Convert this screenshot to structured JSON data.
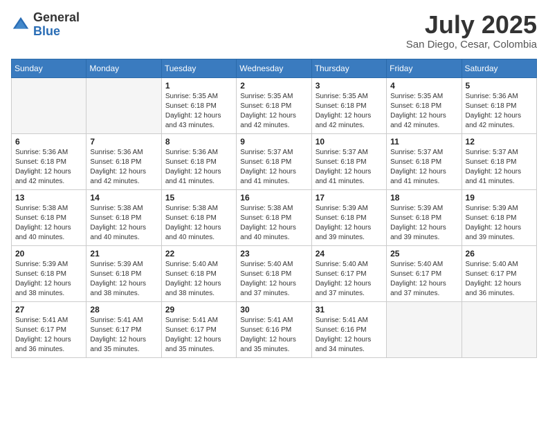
{
  "header": {
    "logo_general": "General",
    "logo_blue": "Blue",
    "month_title": "July 2025",
    "location": "San Diego, Cesar, Colombia"
  },
  "days_of_week": [
    "Sunday",
    "Monday",
    "Tuesday",
    "Wednesday",
    "Thursday",
    "Friday",
    "Saturday"
  ],
  "weeks": [
    [
      {
        "num": "",
        "info": ""
      },
      {
        "num": "",
        "info": ""
      },
      {
        "num": "1",
        "info": "Sunrise: 5:35 AM\nSunset: 6:18 PM\nDaylight: 12 hours\nand 43 minutes."
      },
      {
        "num": "2",
        "info": "Sunrise: 5:35 AM\nSunset: 6:18 PM\nDaylight: 12 hours\nand 42 minutes."
      },
      {
        "num": "3",
        "info": "Sunrise: 5:35 AM\nSunset: 6:18 PM\nDaylight: 12 hours\nand 42 minutes."
      },
      {
        "num": "4",
        "info": "Sunrise: 5:35 AM\nSunset: 6:18 PM\nDaylight: 12 hours\nand 42 minutes."
      },
      {
        "num": "5",
        "info": "Sunrise: 5:36 AM\nSunset: 6:18 PM\nDaylight: 12 hours\nand 42 minutes."
      }
    ],
    [
      {
        "num": "6",
        "info": "Sunrise: 5:36 AM\nSunset: 6:18 PM\nDaylight: 12 hours\nand 42 minutes."
      },
      {
        "num": "7",
        "info": "Sunrise: 5:36 AM\nSunset: 6:18 PM\nDaylight: 12 hours\nand 42 minutes."
      },
      {
        "num": "8",
        "info": "Sunrise: 5:36 AM\nSunset: 6:18 PM\nDaylight: 12 hours\nand 41 minutes."
      },
      {
        "num": "9",
        "info": "Sunrise: 5:37 AM\nSunset: 6:18 PM\nDaylight: 12 hours\nand 41 minutes."
      },
      {
        "num": "10",
        "info": "Sunrise: 5:37 AM\nSunset: 6:18 PM\nDaylight: 12 hours\nand 41 minutes."
      },
      {
        "num": "11",
        "info": "Sunrise: 5:37 AM\nSunset: 6:18 PM\nDaylight: 12 hours\nand 41 minutes."
      },
      {
        "num": "12",
        "info": "Sunrise: 5:37 AM\nSunset: 6:18 PM\nDaylight: 12 hours\nand 41 minutes."
      }
    ],
    [
      {
        "num": "13",
        "info": "Sunrise: 5:38 AM\nSunset: 6:18 PM\nDaylight: 12 hours\nand 40 minutes."
      },
      {
        "num": "14",
        "info": "Sunrise: 5:38 AM\nSunset: 6:18 PM\nDaylight: 12 hours\nand 40 minutes."
      },
      {
        "num": "15",
        "info": "Sunrise: 5:38 AM\nSunset: 6:18 PM\nDaylight: 12 hours\nand 40 minutes."
      },
      {
        "num": "16",
        "info": "Sunrise: 5:38 AM\nSunset: 6:18 PM\nDaylight: 12 hours\nand 40 minutes."
      },
      {
        "num": "17",
        "info": "Sunrise: 5:39 AM\nSunset: 6:18 PM\nDaylight: 12 hours\nand 39 minutes."
      },
      {
        "num": "18",
        "info": "Sunrise: 5:39 AM\nSunset: 6:18 PM\nDaylight: 12 hours\nand 39 minutes."
      },
      {
        "num": "19",
        "info": "Sunrise: 5:39 AM\nSunset: 6:18 PM\nDaylight: 12 hours\nand 39 minutes."
      }
    ],
    [
      {
        "num": "20",
        "info": "Sunrise: 5:39 AM\nSunset: 6:18 PM\nDaylight: 12 hours\nand 38 minutes."
      },
      {
        "num": "21",
        "info": "Sunrise: 5:39 AM\nSunset: 6:18 PM\nDaylight: 12 hours\nand 38 minutes."
      },
      {
        "num": "22",
        "info": "Sunrise: 5:40 AM\nSunset: 6:18 PM\nDaylight: 12 hours\nand 38 minutes."
      },
      {
        "num": "23",
        "info": "Sunrise: 5:40 AM\nSunset: 6:18 PM\nDaylight: 12 hours\nand 37 minutes."
      },
      {
        "num": "24",
        "info": "Sunrise: 5:40 AM\nSunset: 6:17 PM\nDaylight: 12 hours\nand 37 minutes."
      },
      {
        "num": "25",
        "info": "Sunrise: 5:40 AM\nSunset: 6:17 PM\nDaylight: 12 hours\nand 37 minutes."
      },
      {
        "num": "26",
        "info": "Sunrise: 5:40 AM\nSunset: 6:17 PM\nDaylight: 12 hours\nand 36 minutes."
      }
    ],
    [
      {
        "num": "27",
        "info": "Sunrise: 5:41 AM\nSunset: 6:17 PM\nDaylight: 12 hours\nand 36 minutes."
      },
      {
        "num": "28",
        "info": "Sunrise: 5:41 AM\nSunset: 6:17 PM\nDaylight: 12 hours\nand 35 minutes."
      },
      {
        "num": "29",
        "info": "Sunrise: 5:41 AM\nSunset: 6:17 PM\nDaylight: 12 hours\nand 35 minutes."
      },
      {
        "num": "30",
        "info": "Sunrise: 5:41 AM\nSunset: 6:16 PM\nDaylight: 12 hours\nand 35 minutes."
      },
      {
        "num": "31",
        "info": "Sunrise: 5:41 AM\nSunset: 6:16 PM\nDaylight: 12 hours\nand 34 minutes."
      },
      {
        "num": "",
        "info": ""
      },
      {
        "num": "",
        "info": ""
      }
    ]
  ]
}
